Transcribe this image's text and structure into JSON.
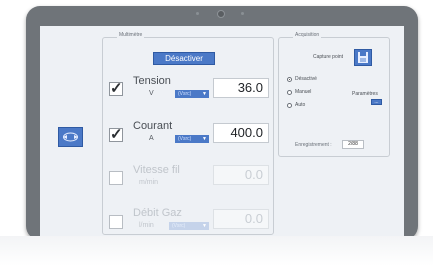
{
  "multimetre": {
    "title": "Multimètre",
    "toggle_label": "Désactiver",
    "params": [
      {
        "name": "Tension",
        "unit": "V",
        "dropdown": "(Vsrc)",
        "value": "36.0",
        "checked": true,
        "enabled": true
      },
      {
        "name": "Courant",
        "unit": "A",
        "dropdown": "(Vsrc)",
        "value": "400.0",
        "checked": true,
        "enabled": true
      },
      {
        "name": "Vitesse fil",
        "unit": "m/min",
        "dropdown": "",
        "value": "0.0",
        "checked": false,
        "enabled": false
      },
      {
        "name": "Débit Gaz",
        "unit": "l/min",
        "dropdown": "(Vsrc)",
        "value": "0.0",
        "checked": false,
        "enabled": false
      }
    ]
  },
  "acquisition": {
    "title": "Acquisition",
    "capture_label": "Capture point",
    "modes": [
      {
        "label": "Désactivé",
        "selected": true
      },
      {
        "label": "Manuel",
        "selected": false
      },
      {
        "label": "Auto",
        "selected": false
      }
    ],
    "params_label": "Paramètres",
    "params_button": "...",
    "record_label": "Enregistrement :",
    "record_value": "2/88"
  },
  "colors": {
    "accent": "#4b79c7",
    "frame": "#6f7479",
    "screen": "#eef1f5"
  },
  "icons": {
    "side": "sync-icon",
    "save": "floppy-disk-icon"
  }
}
